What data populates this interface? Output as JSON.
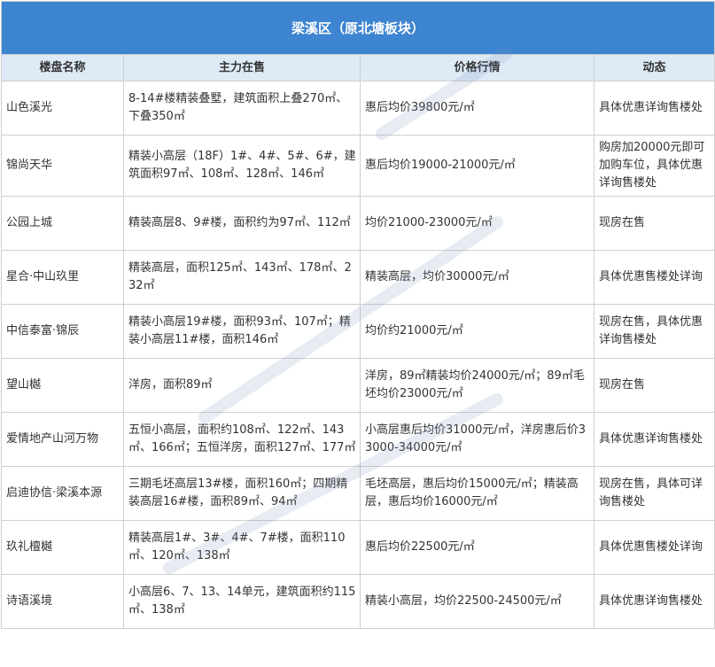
{
  "title": "梁溪区（原北塘板块）",
  "columns": [
    "楼盘名称",
    "主力在售",
    "价格行情",
    "动态"
  ],
  "rows": [
    [
      "山色溪光",
      "8-14#楼精装叠墅，建筑面积上叠270㎡、下叠350㎡",
      "惠后均价39800元/㎡",
      "具体优惠详询售楼处"
    ],
    [
      "锦尚天华",
      "精装小高层（18F）1#、4#、5#、6#，建筑面积97㎡、108㎡、128㎡、146㎡",
      "惠后均价19000-21000元/㎡",
      "购房加20000元即可加购车位，具体优惠详询售楼处"
    ],
    [
      "公园上城",
      "精装高层8、9#楼，面积约为97㎡、112㎡",
      "均价21000-23000元/㎡",
      "现房在售"
    ],
    [
      "星合·中山玖里",
      "精装高层，面积125㎡、143㎡、178㎡、232㎡",
      "精装高层，均价30000元/㎡",
      "具体优惠售楼处详询"
    ],
    [
      "中信泰富·锦辰",
      "精装小高层19#楼，面积93㎡、107㎡；精装小高层11#楼，面积146㎡",
      "均价约21000元/㎡",
      "现房在售，具体优惠详询售楼处"
    ],
    [
      "望山樾",
      "洋房，面积89㎡",
      "洋房，89㎡精装均价24000元/㎡；89㎡毛坯均价23000元/㎡",
      "现房在售"
    ],
    [
      "爱情地产山河万物",
      "五恒小高层，面积约108㎡、122㎡、143㎡、166㎡；五恒洋房，面积127㎡、177㎡",
      "小高层惠后均价31000元/㎡，洋房惠后价33000-34000元/㎡",
      "具体优惠详询售楼处"
    ],
    [
      "启迪协信·梁溪本源",
      "三期毛坯高层13#楼，面积160㎡；四期精装高层16#楼，面积89㎡、94㎡",
      "毛坯高层，惠后均价15000元/㎡；精装高层，惠后均价16000元/㎡",
      "现房在售，具体可详询售楼处"
    ],
    [
      " 玖礼檀樾",
      "精装高层1#、3#、4#、7#楼，面积110㎡、120㎡、138㎡",
      "惠后均价22500元/㎡",
      "具体优惠售楼处详询"
    ],
    [
      "诗语溪境",
      "小高层6、7、13、14单元，建筑面积约115㎡、138㎡",
      "精装小高层，均价22500-24500元/㎡",
      "具体优惠详询售楼处"
    ]
  ],
  "colors": {
    "title_bg": "#3d84d1",
    "header_bg": "#deebf7",
    "border": "#cfcfcf"
  }
}
